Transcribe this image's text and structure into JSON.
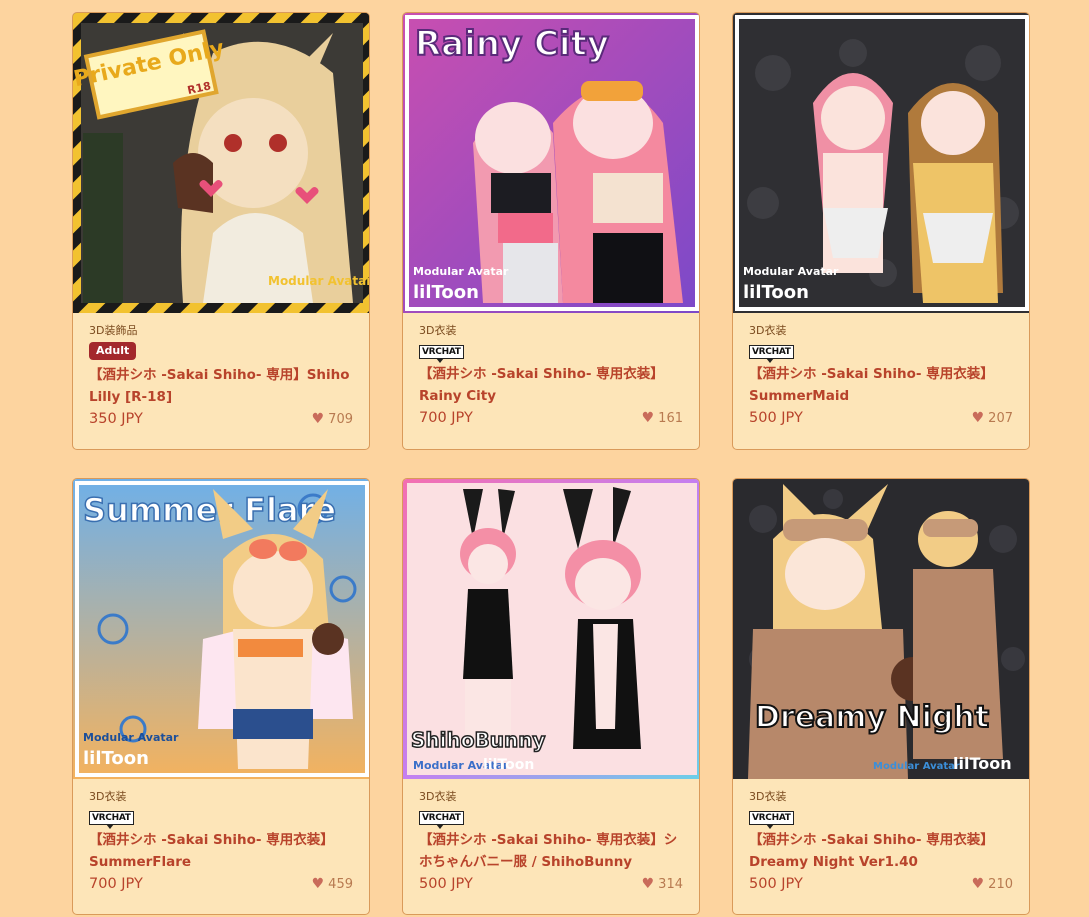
{
  "items": [
    {
      "category": "3D装飾品",
      "badge": "Adult",
      "title": "【酒井シホ -Sakai Shiho- 専用】Shiho Lilly [R-18]",
      "price": "350 JPY",
      "likes": "709",
      "thumb_text": "Private Only",
      "thumb_sub": "R18"
    },
    {
      "category": "3D衣装",
      "badge": "VRCHAT",
      "title": "【酒井シホ -Sakai Shiho- 専用衣装】Rainy City",
      "price": "700 JPY",
      "likes": "161",
      "thumb_text": "Rainy City"
    },
    {
      "category": "3D衣装",
      "badge": "VRCHAT",
      "title": "【酒井シホ -Sakai Shiho- 専用衣装】SummerMaid",
      "price": "500 JPY",
      "likes": "207"
    },
    {
      "category": "3D衣装",
      "badge": "VRCHAT",
      "title": "【酒井シホ -Sakai Shiho- 専用衣装】SummerFlare",
      "price": "700 JPY",
      "likes": "459",
      "thumb_text": "Summer Flare"
    },
    {
      "category": "3D衣装",
      "badge": "VRCHAT",
      "title": "【酒井シホ -Sakai Shiho- 専用衣装】シホちゃんバニー服 / ShihoBunny",
      "price": "500 JPY",
      "likes": "314",
      "thumb_text": "ShihoBunny"
    },
    {
      "category": "3D衣装",
      "badge": "VRCHAT",
      "title": "【酒井シホ -Sakai Shiho- 専用衣装】Dreamy Night Ver1.40",
      "price": "500 JPY",
      "likes": "210",
      "thumb_text": "Dreamy Night"
    }
  ],
  "thumb_logos": {
    "modular": "Modular Avatar",
    "liltoon": "lilToon"
  },
  "icons": {
    "like": "heart-icon"
  },
  "colors": {
    "page_bg": "#fdd49f",
    "card_bg": "#fde5b8",
    "title": "#b8432b",
    "adult_badge": "#a3282c"
  }
}
